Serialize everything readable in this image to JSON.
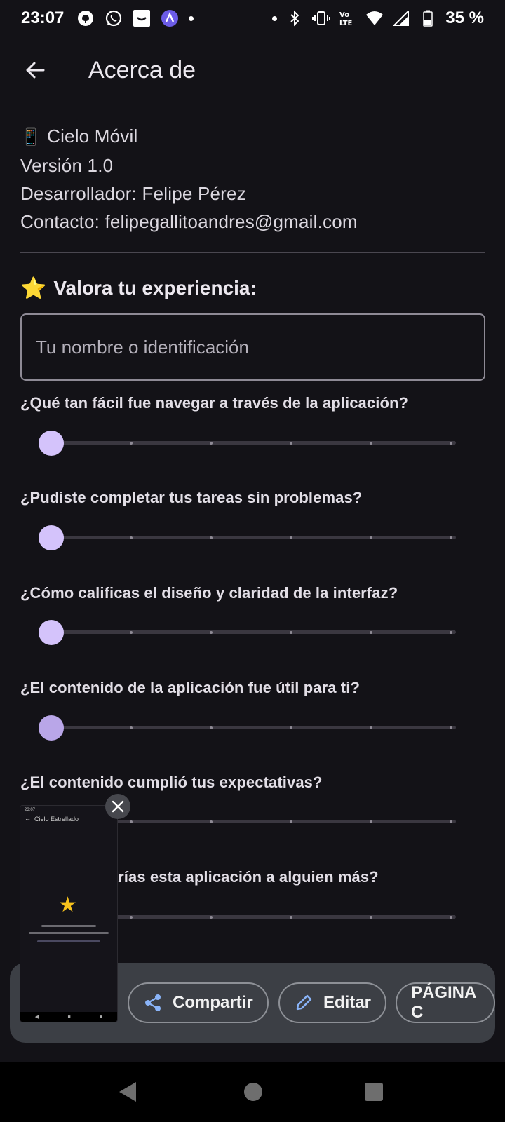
{
  "status_bar": {
    "time": "23:07",
    "battery": "35 %"
  },
  "app_bar": {
    "title": "Acerca de"
  },
  "info": {
    "emoji": "📱",
    "app_name": "Cielo Móvil",
    "version": "Versión 1.0",
    "developer": "Desarrollador: Felipe Pérez",
    "contact": "Contacto: felipegallitoandres@gmail.com"
  },
  "rating": {
    "star": "⭐",
    "title": "Valora tu experiencia:",
    "name_placeholder": "Tu nombre o identificación",
    "questions": [
      {
        "text": "¿Qué tan fácil fue navegar a través de la aplicación?",
        "value": 0
      },
      {
        "text": "¿Pudiste completar tus tareas sin problemas?",
        "value": 0
      },
      {
        "text": "¿Cómo calificas el diseño y claridad de la interfaz?",
        "value": 0
      },
      {
        "text": "¿El contenido de la aplicación fue útil para ti?",
        "value": 0
      },
      {
        "text": "¿El contenido cumplió tus expectativas?",
        "value": 0
      },
      {
        "text": "¿Recomendarías esta aplicación a alguien más?",
        "value": 0
      }
    ]
  },
  "share_sheet": {
    "share_label": "Compartir",
    "edit_label": "Editar",
    "page_label": "PÁGINA C"
  },
  "thumbnail": {
    "title": "Cielo Estrellado"
  }
}
